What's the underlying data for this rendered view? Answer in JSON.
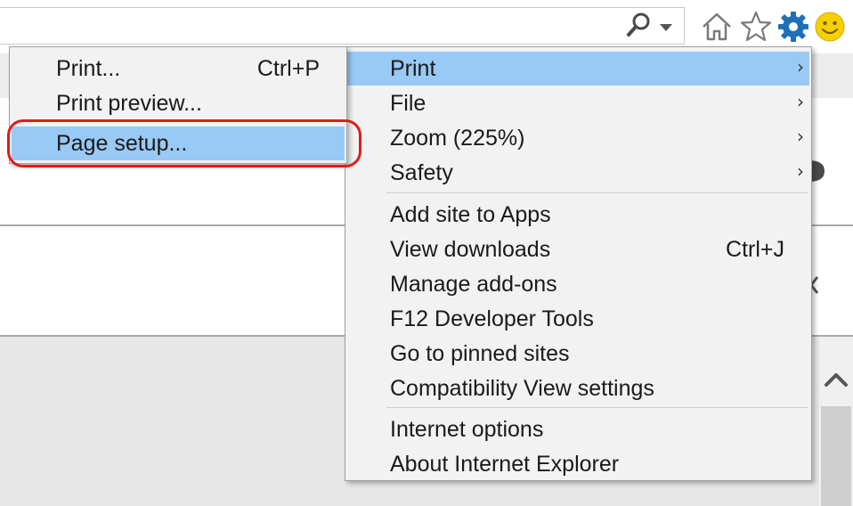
{
  "tools_menu": {
    "items": [
      {
        "label": "Print",
        "shortcut": "",
        "arrow": "›"
      },
      {
        "label": "File",
        "shortcut": "",
        "arrow": "›"
      },
      {
        "label": "Zoom (225%)",
        "shortcut": "",
        "arrow": "›"
      },
      {
        "label": "Safety",
        "shortcut": "",
        "arrow": "›"
      },
      {
        "label": "Add site to Apps",
        "shortcut": ""
      },
      {
        "label": "View downloads",
        "shortcut": "Ctrl+J"
      },
      {
        "label": "Manage add-ons",
        "shortcut": ""
      },
      {
        "label": "F12 Developer Tools",
        "shortcut": ""
      },
      {
        "label": "Go to pinned sites",
        "shortcut": ""
      },
      {
        "label": "Compatibility View settings",
        "shortcut": ""
      },
      {
        "label": "Internet options",
        "shortcut": ""
      },
      {
        "label": "About Internet Explorer",
        "shortcut": ""
      }
    ],
    "highlighted_item": "Print"
  },
  "print_submenu": {
    "items": [
      {
        "label": "Print...",
        "shortcut": "Ctrl+P"
      },
      {
        "label": "Print preview...",
        "shortcut": ""
      },
      {
        "label": "Page setup...",
        "shortcut": ""
      }
    ],
    "highlighted_item": "Page setup..."
  },
  "colors": {
    "highlight": "#99c9f5",
    "menu_bg": "#f2f2f2",
    "annotation_ring": "#e21b1b",
    "gear": "#1f6fb8",
    "smiley": "#f5d000"
  },
  "icons": [
    "search-icon",
    "chevron-down-icon",
    "home-icon",
    "star-icon",
    "gear-icon",
    "smiley-icon",
    "chevron-up-icon"
  ]
}
